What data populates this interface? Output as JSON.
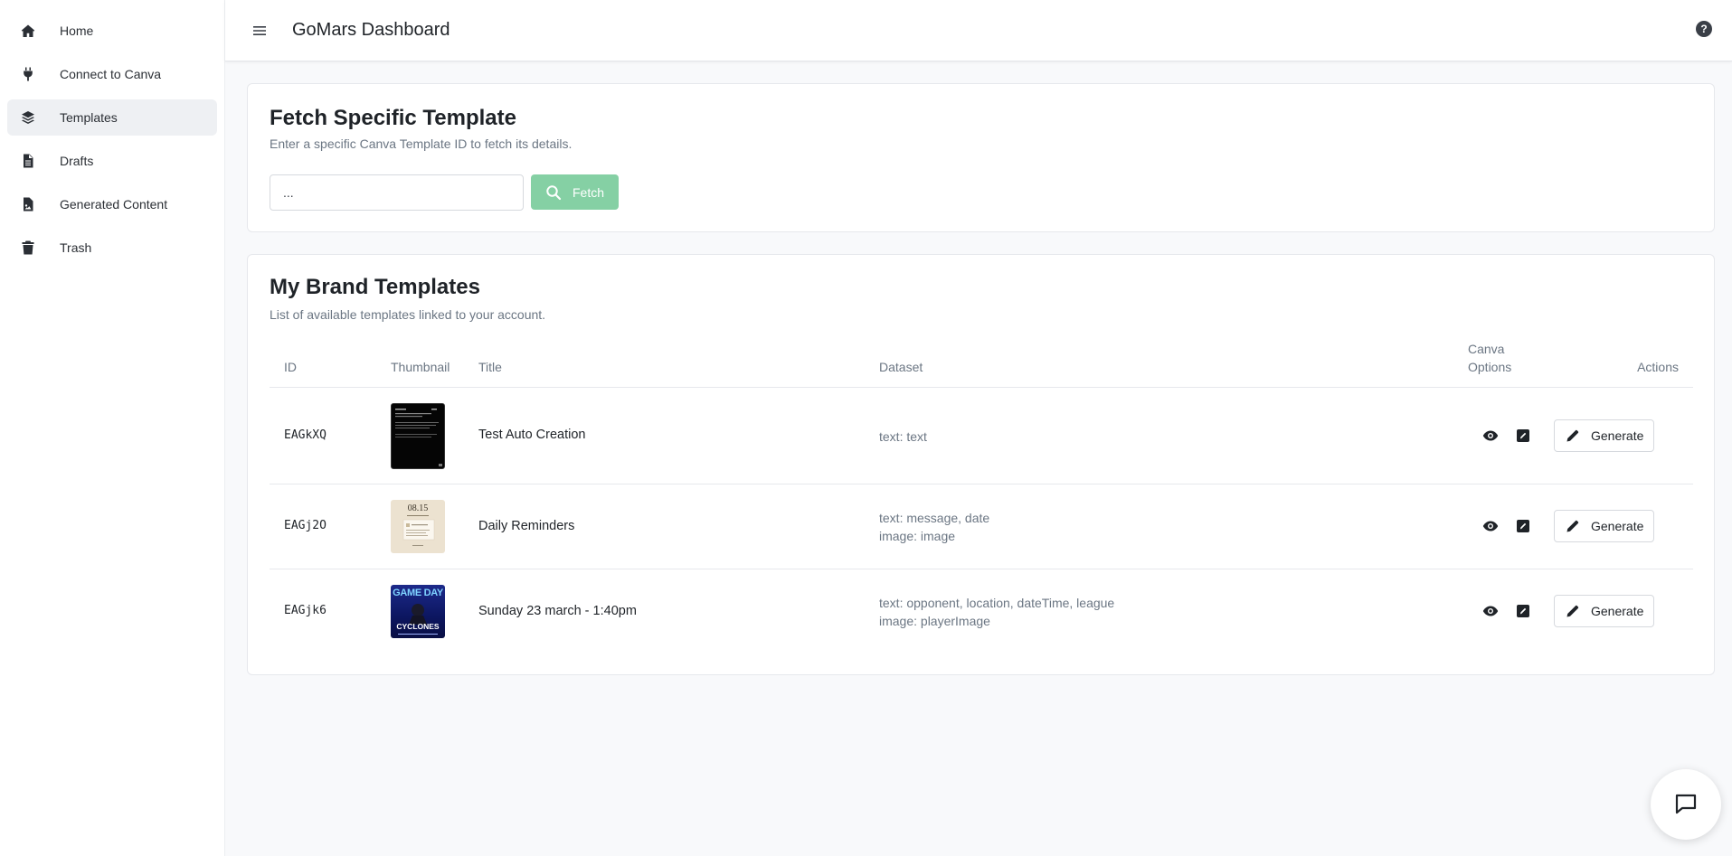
{
  "sidebar": {
    "items": [
      {
        "label": "Home",
        "icon": "home-icon",
        "active": false
      },
      {
        "label": "Connect to Canva",
        "icon": "plug-icon",
        "active": false
      },
      {
        "label": "Templates",
        "icon": "layers-icon",
        "active": true
      },
      {
        "label": "Drafts",
        "icon": "file-icon",
        "active": false
      },
      {
        "label": "Generated Content",
        "icon": "file-image-icon",
        "active": false
      },
      {
        "label": "Trash",
        "icon": "trash-icon",
        "active": false
      }
    ]
  },
  "header": {
    "title": "GoMars Dashboard",
    "help_label": "?"
  },
  "fetch": {
    "title": "Fetch Specific Template",
    "subtitle": "Enter a specific Canva Template ID to fetch its details.",
    "input_value": "...",
    "button_label": "Fetch",
    "button_color": "#85d0a4"
  },
  "templates": {
    "title": "My Brand Templates",
    "subtitle": "List of available templates linked to your account.",
    "columns": {
      "id": "ID",
      "thumbnail": "Thumbnail",
      "title": "Title",
      "dataset": "Dataset",
      "canva_options_1": "Canva",
      "canva_options_2": "Options",
      "actions": "Actions"
    },
    "rows": [
      {
        "id": "EAGkXQ",
        "title": "Test Auto Creation",
        "dataset_line1": "text: text",
        "dataset_line2": "",
        "action": "Generate"
      },
      {
        "id": "EAGj2O",
        "title": "Daily Reminders",
        "dataset_line1": "text: message, date",
        "dataset_line2": "image: image",
        "action": "Generate",
        "thumb_text": "08.15"
      },
      {
        "id": "EAGjk6",
        "title": "Sunday 23 march - 1:40pm",
        "dataset_line1": "text: opponent, location, dateTime, league",
        "dataset_line2": "image: playerImage",
        "action": "Generate",
        "thumb_text_1": "GAME DAY",
        "thumb_text_2": "CYCLONES"
      }
    ]
  }
}
